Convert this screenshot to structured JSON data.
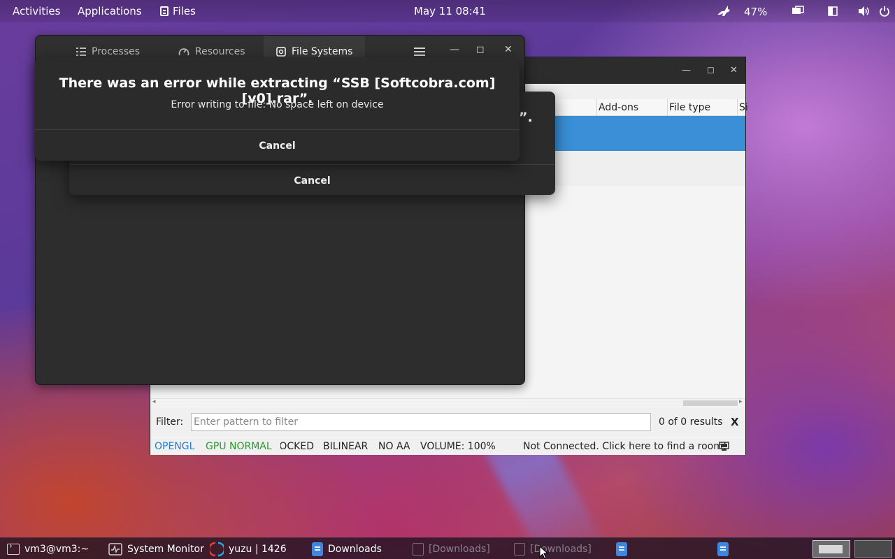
{
  "topbar": {
    "activities": "Activities",
    "applications": "Applications",
    "files": "Files",
    "clock": "May 11  08:41",
    "battery": "47%",
    "icons": [
      "rabbit-icon",
      "battery-icon",
      "screen-icon",
      "layout-icon",
      "volume-icon",
      "power-icon"
    ]
  },
  "sysmon": {
    "tabs": [
      {
        "label": "Processes",
        "icon": "list-icon"
      },
      {
        "label": "Resources",
        "icon": "gauge-icon"
      },
      {
        "label": "File Systems",
        "icon": "disk-icon"
      }
    ],
    "active_tab": "File Systems"
  },
  "dialog_front": {
    "title": "There was an error while extracting “SSB [Softcobra.com][v0].rar”.",
    "message": "Error writing to file: No space left on device",
    "cancel": "Cancel"
  },
  "dialog_back": {
    "title_fragment": "”.",
    "cancel": "Cancel"
  },
  "yuzu": {
    "columns": [
      "Add-ons",
      "File type",
      "Si"
    ],
    "filter_label": "Filter:",
    "filter_placeholder": "Enter pattern to filter",
    "results": "0 of 0 results",
    "clear": "X",
    "status": {
      "api": "OPENGL",
      "gpu": "GPU NORMAL",
      "docked": "DOCKED",
      "filter": "BILINEAR",
      "aa": "NO AA",
      "volume": "VOLUME: 100%",
      "room": "Not Connected. Click here to find a room!"
    },
    "colors": {
      "api": "#2a7bd6",
      "gpu": "#2a9a2a",
      "selection": "#3a8fd6"
    }
  },
  "taskbar": {
    "items": [
      {
        "label": "vm3@vm3:~",
        "icon": "terminal-icon"
      },
      {
        "label": "System Monitor",
        "icon": "monitor-icon"
      },
      {
        "label": "yuzu | 1426",
        "icon": "yuzu-icon"
      },
      {
        "label": "Downloads",
        "icon": "files-icon"
      },
      {
        "label": "[Downloads]",
        "icon": "document-icon"
      },
      {
        "label": "[Downloads]",
        "icon": "document-icon"
      }
    ]
  }
}
